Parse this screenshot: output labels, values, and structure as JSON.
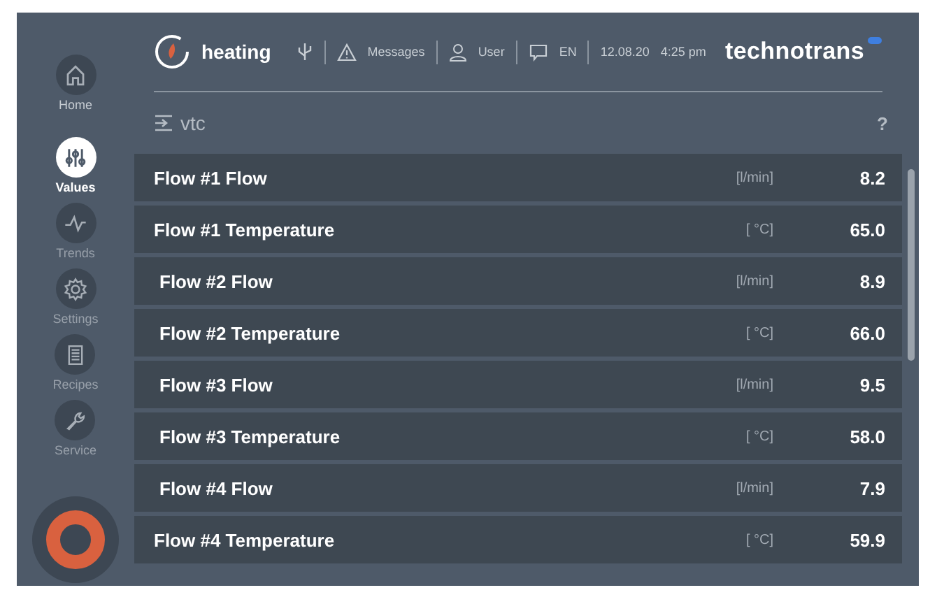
{
  "nav": [
    {
      "label": "Home",
      "kind": "home",
      "selected": false
    },
    {
      "label": "Values",
      "kind": "sliders",
      "selected": true
    },
    {
      "label": "Trends",
      "kind": "trend",
      "selected": false
    },
    {
      "label": "Settings",
      "kind": "gear",
      "selected": false
    },
    {
      "label": "Recipes",
      "kind": "doc",
      "selected": false
    },
    {
      "label": "Service",
      "kind": "wrench",
      "selected": false
    }
  ],
  "header": {
    "mode": "heating",
    "messages": "Messages",
    "user": "User",
    "language": "EN",
    "date": "12.08.20",
    "time": "4:25 pm",
    "brand": "technotrans"
  },
  "section": {
    "title": "vtc",
    "help": "?"
  },
  "rows": [
    {
      "name": "Flow #1 Flow",
      "unit": "[l/min]",
      "value": "8.2"
    },
    {
      "name": "Flow #1 Temperature",
      "unit": "[ °C]",
      "value": "65.0"
    },
    {
      "name": "Flow #2 Flow",
      "unit": "[l/min]",
      "value": "8.9"
    },
    {
      "name": "Flow #2 Temperature",
      "unit": "[ °C]",
      "value": "66.0"
    },
    {
      "name": "Flow #3 Flow",
      "unit": "[l/min]",
      "value": "9.5"
    },
    {
      "name": "Flow #3 Temperature",
      "unit": "[ °C]",
      "value": "58.0"
    },
    {
      "name": "Flow #4 Flow",
      "unit": "[l/min]",
      "value": "7.9"
    },
    {
      "name": "Flow #4 Temperature",
      "unit": "[ °C]",
      "value": "59.9"
    }
  ]
}
